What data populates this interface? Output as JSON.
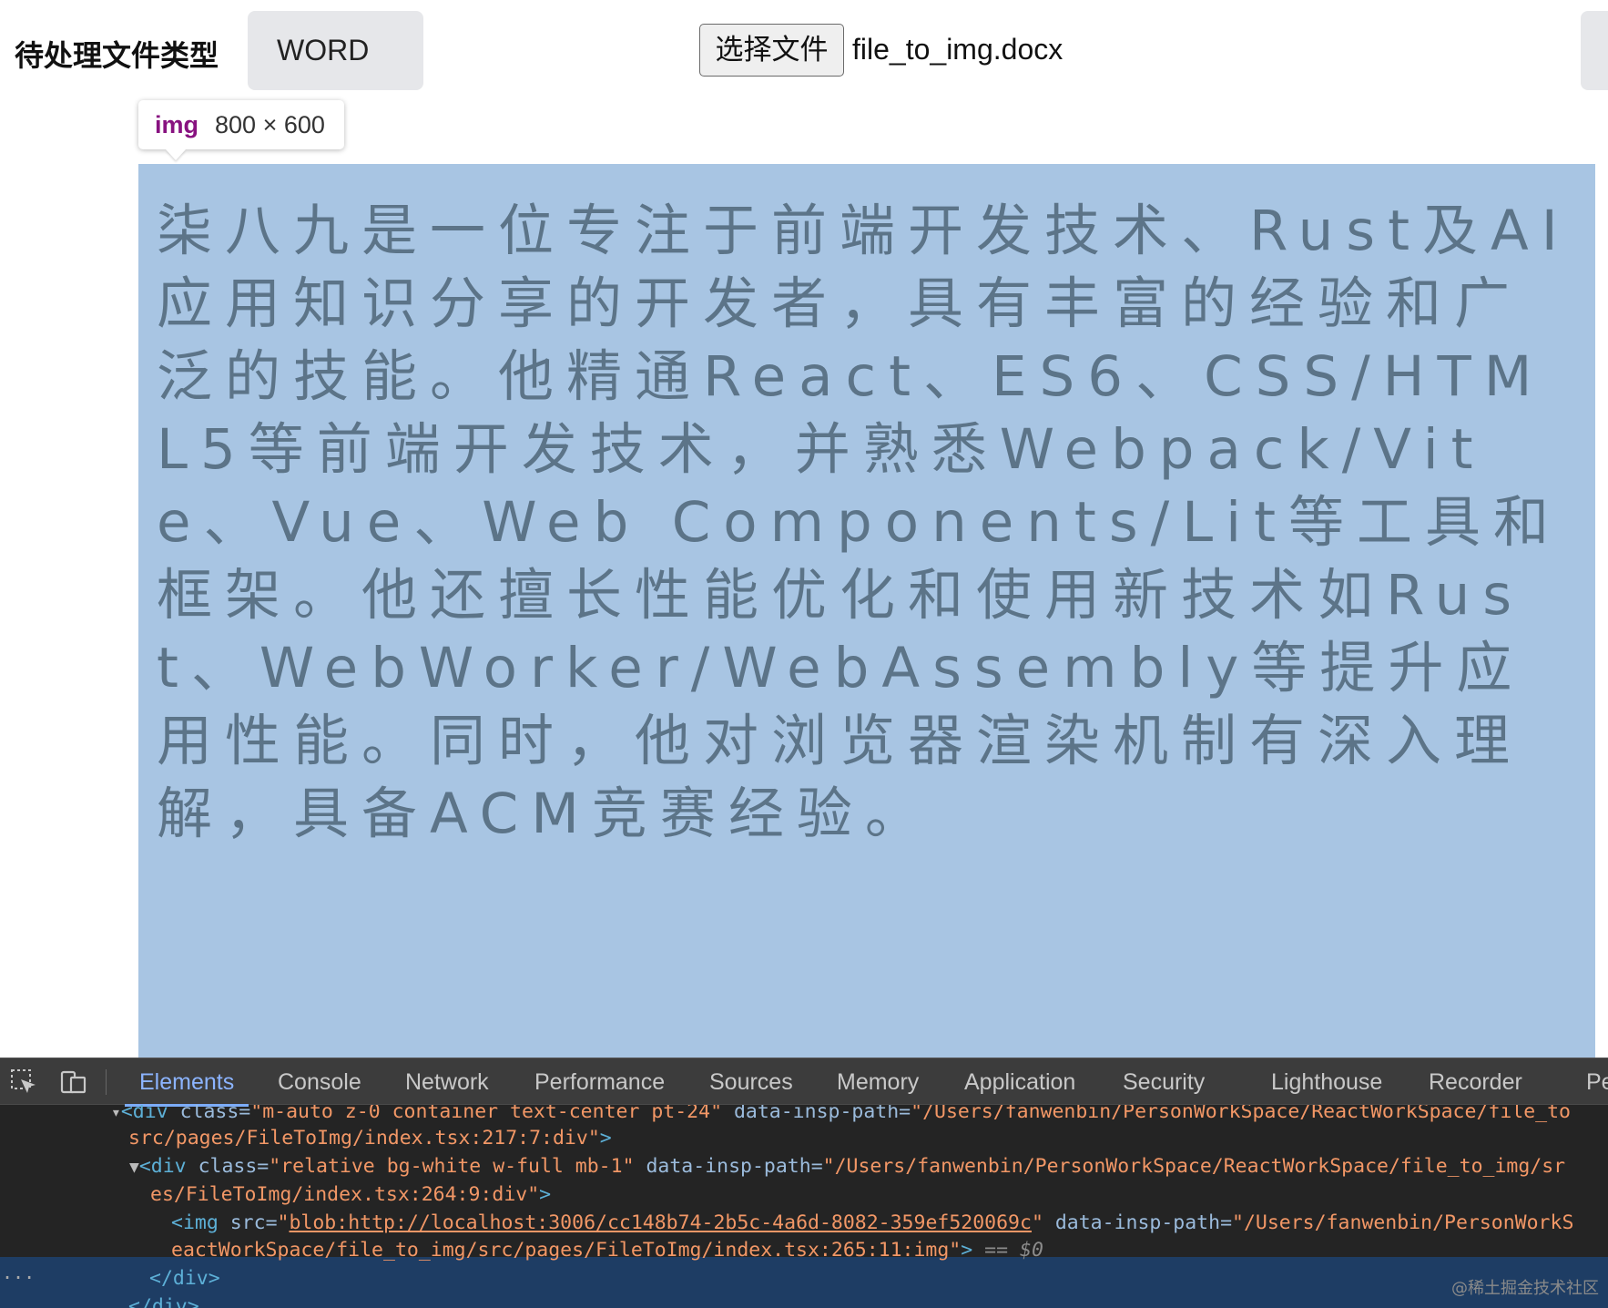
{
  "toolbar": {
    "filetype_label": "待处理文件类型",
    "filetype_value": "WORD",
    "choose_file_button": "选择文件",
    "file_name": "file_to_img.docx"
  },
  "tooltip": {
    "tag": "img",
    "dimensions": "800 × 600"
  },
  "image_text": "柒八九是一位专注于前端开发技术、Rust及AI应用知识分享的开发者，具有丰富的经验和广泛的技能。他精通React、ES6、CSS/HTML5等前端开发技术，并熟悉Webpack/Vite、Vue、Web Components/Lit等工具和框架。他还擅长性能优化和使用新技术如Rust、WebWorker/WebAssembly等提升应用性能。同时，他对浏览器渲染机制有深入理解，具备ACM竞赛经验。",
  "devtools": {
    "tabs": [
      "Elements",
      "Console",
      "Network",
      "Performance",
      "Sources",
      "Memory",
      "Application",
      "Security",
      "Lighthouse",
      "Recorder",
      "Pe"
    ],
    "active_tab": "Elements",
    "lines": {
      "l0": {
        "prefix": "<div ",
        "attr1": "class=",
        "val1": "\"m-auto z-0 container text-center pt-24\"",
        "attr2": " data-insp-path=",
        "val2": "\"/Users/fanwenbin/PersonWorkSpace/ReactWorkSpace/file_to"
      },
      "l1": {
        "val": "src/pages/FileToImg/index.tsx:217:7:div\"",
        "suffix": ">"
      },
      "l2": {
        "tag": "<div ",
        "attr1": "class=",
        "val1": "\"relative bg-white w-full mb-1\"",
        "attr2": " data-insp-path=",
        "val2": "\"/Users/fanwenbin/PersonWorkSpace/ReactWorkSpace/file_to_img/sr"
      },
      "l3": {
        "val": "es/FileToImg/index.tsx:264:9:div\"",
        "suffix": ">"
      },
      "l4": {
        "tag": "<img ",
        "attr1": "src=",
        "q": "\"",
        "link": "blob:http://localhost:3006/cc148b74-2b5c-4a6d-8082-359ef520069c",
        "attr2": " data-insp-path=",
        "val2": "\"/Users/fanwenbin/PersonWorkS"
      },
      "l5": {
        "val": "eactWorkSpace/file_to_img/src/pages/FileToImg/index.tsx:265:11:img\"",
        "suffix": ">",
        "eq": " == $0"
      },
      "l6": {
        "tag": "</div>"
      },
      "l7": {
        "tag": "</div>"
      }
    },
    "ellipsis": "..."
  },
  "watermark": "@稀土掘金技术社区"
}
